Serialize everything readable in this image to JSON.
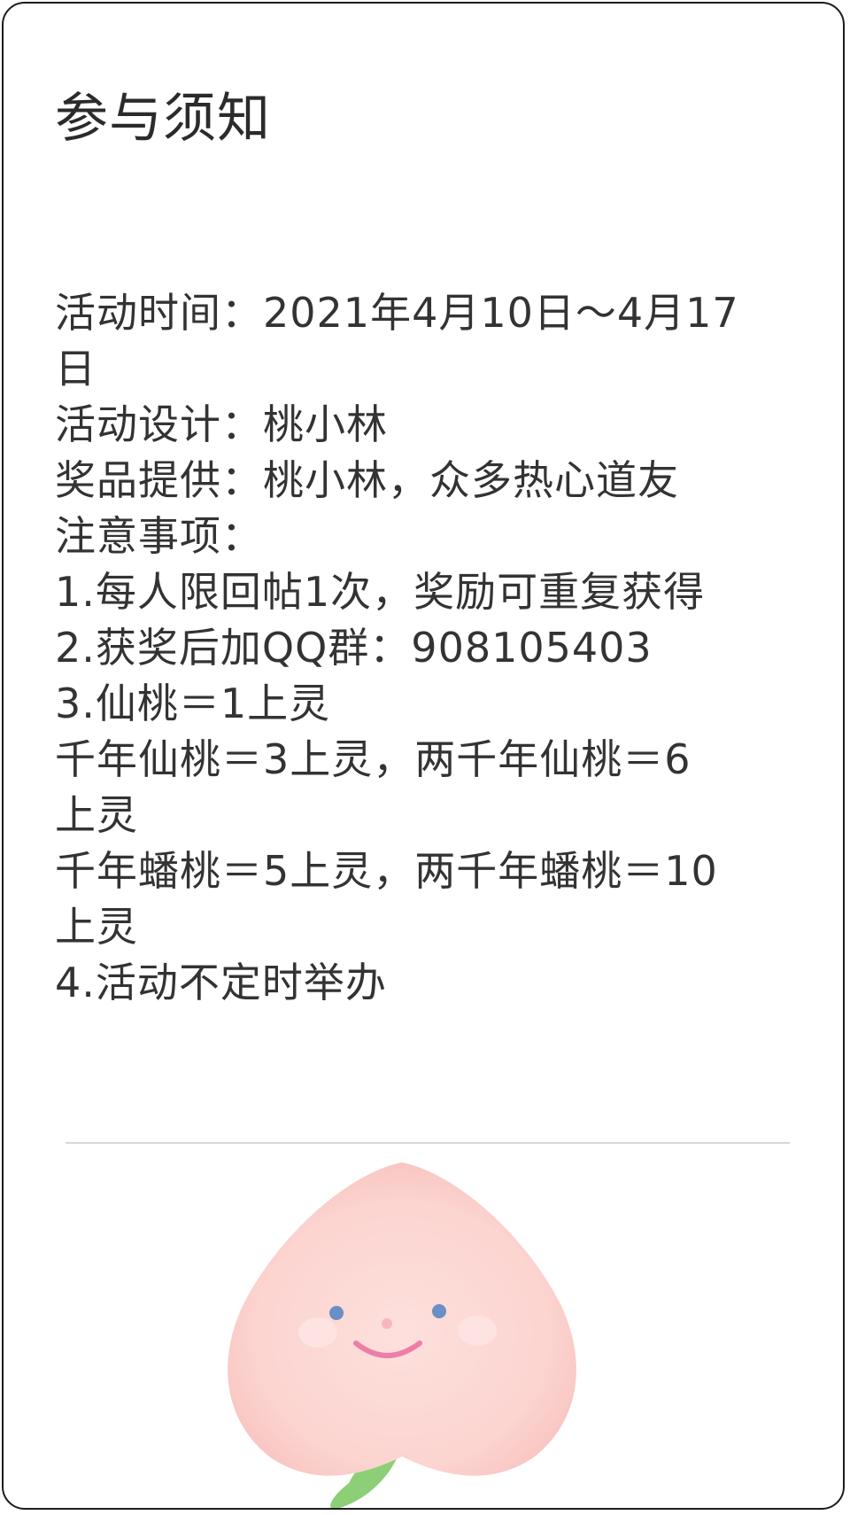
{
  "notice": {
    "title": "参与须知",
    "lines": [
      "活动时间：2021年4月10日～4月17",
      "日",
      "活动设计：桃小林",
      "奖品提供：桃小林，众多热心道友",
      "注意事项：",
      "1.每人限回帖1次，奖励可重复获得",
      "2.获奖后加QQ群：908105403",
      "3.仙桃＝1上灵",
      "千年仙桃＝3上灵，两千年仙桃＝6",
      "上灵",
      "千年蟠桃＝5上灵，两千年蟠桃＝10",
      "上灵",
      "4.活动不定时举办"
    ]
  },
  "illustration": {
    "name": "peach-mascot",
    "colors": {
      "peach": "#fcd4d0",
      "cheek": "#fde3e1",
      "eye": "#6a8fc4",
      "mouth": "#ec7fa8",
      "nose": "#f6b8bc",
      "leaf": "#8ccf76"
    }
  }
}
